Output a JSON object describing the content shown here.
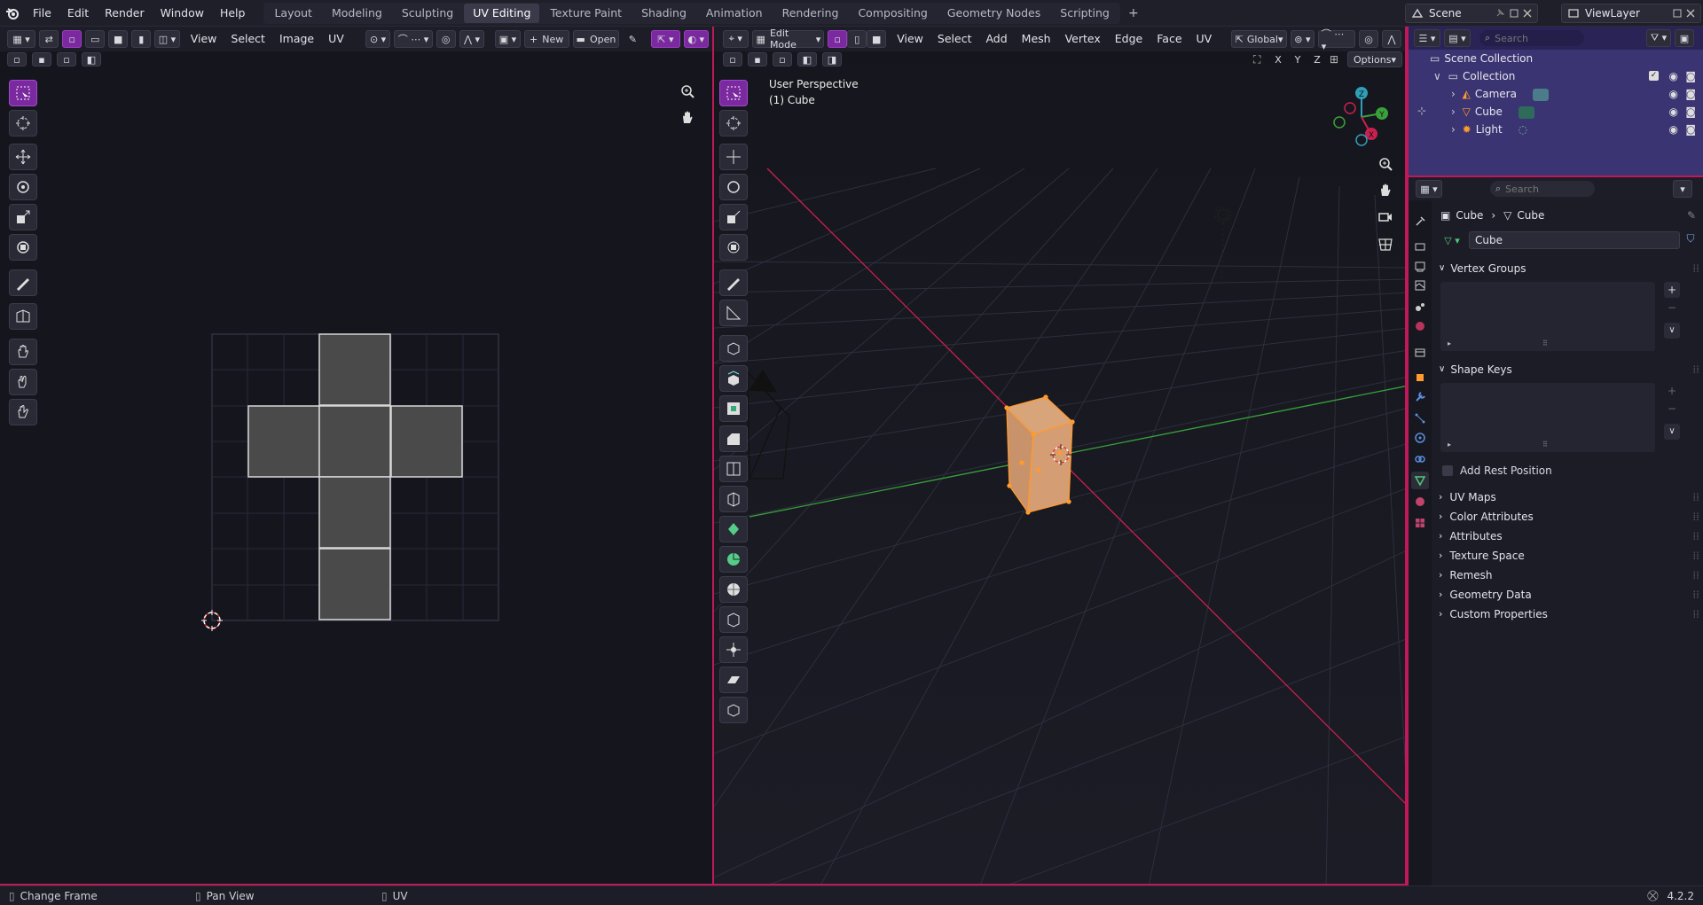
{
  "app": {
    "name": "Blender",
    "version": "4.2.2"
  },
  "menus": [
    "File",
    "Edit",
    "Render",
    "Window",
    "Help"
  ],
  "workspaces": [
    "Layout",
    "Modeling",
    "Sculpting",
    "UV Editing",
    "Texture Paint",
    "Shading",
    "Animation",
    "Rendering",
    "Compositing",
    "Geometry Nodes",
    "Scripting"
  ],
  "active_workspace": "UV Editing",
  "scene": {
    "name": "Scene",
    "view_layer": "ViewLayer"
  },
  "uv_editor": {
    "menus": [
      "View",
      "Select",
      "Image",
      "UV"
    ],
    "new_label": "New",
    "open_label": "Open",
    "tools": [
      "select-box",
      "cursor",
      "move",
      "rotate",
      "scale",
      "transform",
      "annotate",
      "rip",
      "grab",
      "relax",
      "pinch"
    ]
  },
  "viewport": {
    "mode": "Edit Mode",
    "menus": [
      "View",
      "Select",
      "Add",
      "Mesh",
      "Vertex",
      "Edge",
      "Face",
      "UV"
    ],
    "orientation": "Global",
    "options_label": "Options",
    "xyz": [
      "X",
      "Y",
      "Z"
    ],
    "perspective_label": "User Perspective",
    "object_label": "(1) Cube",
    "gizmo": {
      "z": "Z",
      "y": "Y",
      "x": "X"
    }
  },
  "outliner": {
    "search_placeholder": "Search",
    "scene_collection": "Scene Collection",
    "collection": "Collection",
    "items": [
      {
        "name": "Camera",
        "icon": "camera-icon"
      },
      {
        "name": "Cube",
        "icon": "mesh-icon"
      },
      {
        "name": "Light",
        "icon": "light-icon"
      }
    ]
  },
  "properties": {
    "search_placeholder": "Search",
    "breadcrumb": [
      "Cube",
      "Cube"
    ],
    "mesh_name": "Cube",
    "vertex_groups": "Vertex Groups",
    "shape_keys": "Shape Keys",
    "add_rest_position": "Add Rest Position",
    "collapsed_panels": [
      "UV Maps",
      "Color Attributes",
      "Attributes",
      "Texture Space",
      "Remesh",
      "Geometry Data",
      "Custom Properties"
    ]
  },
  "status": {
    "left": "Change Frame",
    "middle": "Pan View",
    "right": "UV",
    "version": "4.2.2"
  },
  "colors": {
    "accent": "#7a2a9e",
    "border": "#c0185a",
    "outliner_bg": "#3b3472",
    "selected_orange": "#ff9a2e",
    "axis_x": "#c8214f",
    "axis_y": "#3aa13a"
  }
}
